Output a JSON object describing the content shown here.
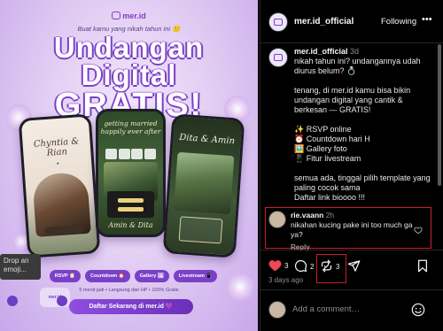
{
  "promo": {
    "brand": "mer.id",
    "tagline": "Buat kamu yang nikah tahun ini 🙂",
    "headline_1": "Undangan",
    "headline_2": "Digital",
    "headline_3": "GRATIS!",
    "phone1_names": "Chyntia & Rian",
    "phone2_script": "getting married happily ever after",
    "phone2_sign": "Amin & Dita",
    "phone3_names": "Dita & Amin",
    "chips": [
      "RSVP 📋",
      "Countdown ⏰",
      "Gallery 🖼",
      "Livestream 📱"
    ],
    "sub": "5 menit jadi • Langsung dari HP • 100% Gratis",
    "cta": "Daftar Sekarang di mer.id 💜"
  },
  "overlay": {
    "tooltip": "Drop an emoji...",
    "mini_profile": "mer.id"
  },
  "header": {
    "username": "mer.id_official",
    "follow_label": "Following",
    "more_label": "•••"
  },
  "caption": {
    "username": "mer.id_official",
    "time": "3d",
    "line1": "nikah tahun ini? undangannya udah diurus belum? 💍",
    "para2": "tenang, di mer.id kamu bisa bikin undangan digital yang cantik & berkesan — GRATIS!",
    "features": [
      "✨ RSVP online",
      "⏰ Countdown hari H",
      "🖼️ Gallery foto",
      "📱 Fitur livestream"
    ],
    "para4": "semua ada, tinggal pilih template yang paling cocok sama",
    "para5": "Daftar link bioooo !!!"
  },
  "comment": {
    "username": "rie.vaann",
    "time": "2h",
    "text": "nikahan kucing pake ini too much ga ya?",
    "reply_label": "Reply"
  },
  "actions": {
    "likes": "3",
    "comments": "2",
    "reposts": "3",
    "posted_ago": "3 days ago"
  },
  "add_comment": {
    "placeholder": "Add a comment…"
  },
  "colors": {
    "accent": "#7a40c8",
    "like_red": "#ed4956",
    "highlight_border": "#d11a2a"
  }
}
